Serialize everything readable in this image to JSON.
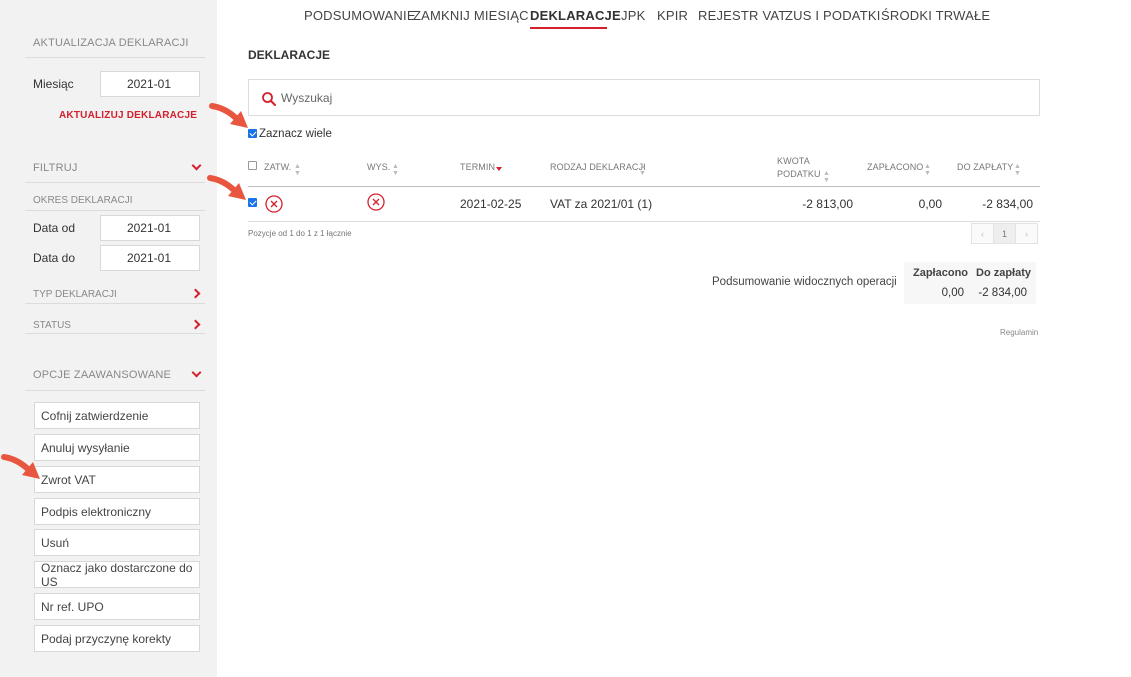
{
  "nav": {
    "items": [
      "PODSUMOWANIE",
      "ZAMKNIJ MIESIĄC",
      "DEKLARACJE",
      "JPK",
      "KPIR",
      "REJESTR VAT",
      "ZUS I PODATKI",
      "ŚRODKI TRWAŁE"
    ],
    "active": "DEKLARACJE"
  },
  "sidebar": {
    "update_title": "AKTUALIZACJA DEKLARACJI",
    "month_label": "Miesiąc",
    "month_value": "2021-01",
    "update_link": "AKTUALIZUJ DEKLARACJE",
    "filter_title": "FILTRUJ",
    "period_title": "OKRES DEKLARACJI",
    "date_from_label": "Data od",
    "date_from_value": "2021-01",
    "date_to_label": "Data do",
    "date_to_value": "2021-01",
    "type_title": "TYP DEKLARACJI",
    "status_title": "STATUS",
    "advanced_title": "OPCJE ZAAWANSOWANE",
    "advanced_buttons": [
      "Cofnij zatwierdzenie",
      "Anuluj wysyłanie",
      "Zwrot VAT",
      "Podpis elektroniczny",
      "Usuń",
      "Oznacz jako dostarczone do US",
      "Nr ref. UPO",
      "Podaj przyczynę korekty"
    ]
  },
  "main": {
    "title": "DEKLARACJE",
    "search_placeholder": "Wyszukaj",
    "select_many_label": "Zaznacz wiele",
    "select_many_checked": true,
    "columns": {
      "approved": "ZATW.",
      "sent": "WYS.",
      "deadline": "TERMIN",
      "type": "RODZAJ DEKLARACJI",
      "tax_amount_1": "KWOTA",
      "tax_amount_2": "PODATKU",
      "paid": "ZAPŁACONO",
      "to_pay": "DO ZAPŁATY"
    },
    "rows": [
      {
        "checked": true,
        "deadline": "2021-02-25",
        "type": "VAT za 2021/01 (1)",
        "tax_amount": "-2 813,00",
        "paid": "0,00",
        "to_pay": "-2 834,00"
      }
    ],
    "position_info": "Pozycje od 1 do 1 z 1 łącznie",
    "pager": {
      "prev": "‹",
      "current": "1",
      "next": "›"
    },
    "summary": {
      "label": "Podsumowanie widocznych operacji",
      "paid_header": "Zapłacono",
      "to_pay_header": "Do zapłaty",
      "paid_value": "0,00",
      "to_pay_value": "-2 834,00"
    },
    "footer_link": "Regulamin"
  },
  "colors": {
    "accent": "#d4202c",
    "arrow": "#e8563f",
    "sidebar_bg": "#f2f2f2"
  }
}
